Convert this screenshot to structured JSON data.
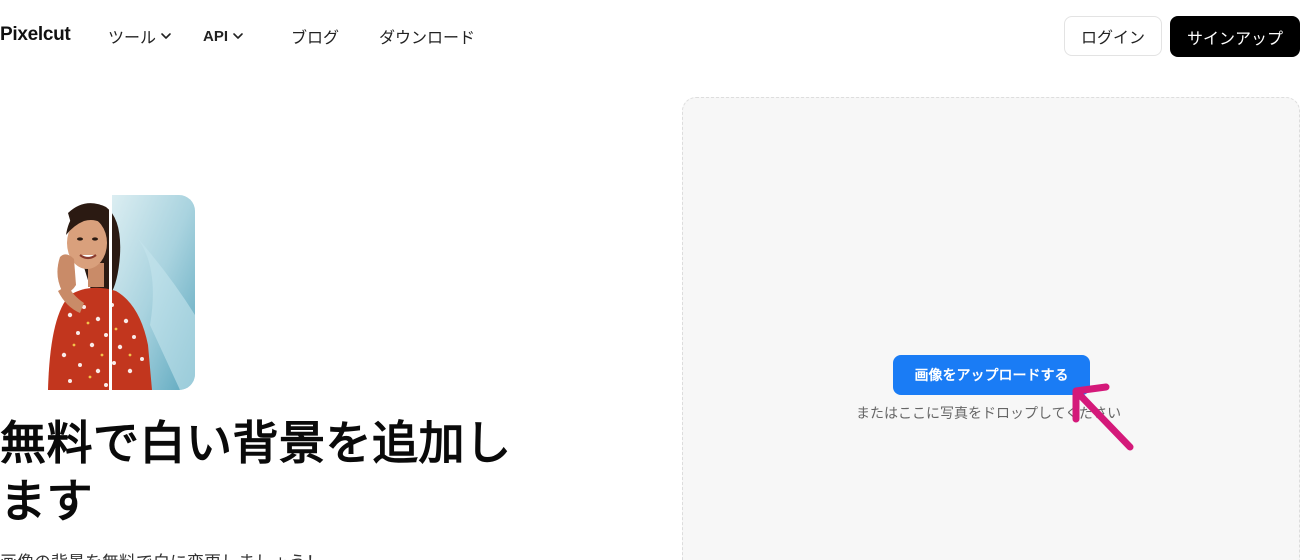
{
  "header": {
    "logo": "Pixelcut",
    "nav": [
      {
        "label": "ツール",
        "has_dropdown": true
      },
      {
        "label": "API",
        "has_dropdown": true
      },
      {
        "label": "ブログ",
        "has_dropdown": false
      },
      {
        "label": "ダウンロード",
        "has_dropdown": false
      }
    ],
    "login_label": "ログイン",
    "signup_label": "サインアップ"
  },
  "hero": {
    "title_line1": "無料で白い背景を追加し",
    "title_line2": "ます",
    "subtitle": "画像の背景を無料で白に変更しましょう！"
  },
  "upload": {
    "button_label": "画像をアップロードする",
    "drop_hint": "またはここに写真をドロップしてください"
  },
  "colors": {
    "upload_button": "#1a7cf5",
    "signup_button": "#000000",
    "annotation_arrow": "#d4197a"
  }
}
